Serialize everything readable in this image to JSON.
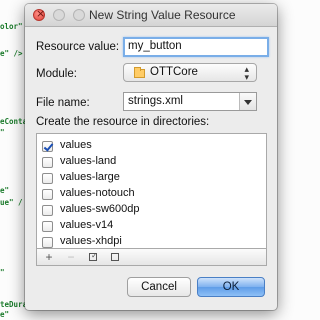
{
  "editor": {
    "lines": [
      {
        "text": "olor\"",
        "tail": ""
      },
      {
        "text": "e\" />",
        "tail": ""
      },
      {
        "text": "eConta",
        "tail": ""
      },
      {
        "text": "\"",
        "tail": ""
      },
      {
        "text": "e\"",
        "tail": ""
      },
      {
        "text": "ue\" /",
        "tail": ""
      },
      {
        "text": "\"",
        "tail": ""
      },
      {
        "text": "teDuration",
        "tail": ""
      },
      {
        "text": "e\"",
        "tail": ""
      }
    ]
  },
  "dialog": {
    "title": "New String Value Resource",
    "resource_value": {
      "label": "Resource value:",
      "value": "my_button"
    },
    "module": {
      "label": "Module:",
      "selected": "OTTCore"
    },
    "file_name": {
      "label": "File name:",
      "value": "strings.xml"
    },
    "directories": {
      "label": "Create the resource in directories:",
      "items": [
        {
          "name": "values",
          "checked": true
        },
        {
          "name": "values-land",
          "checked": false
        },
        {
          "name": "values-large",
          "checked": false
        },
        {
          "name": "values-notouch",
          "checked": false
        },
        {
          "name": "values-sw600dp",
          "checked": false
        },
        {
          "name": "values-v14",
          "checked": false
        },
        {
          "name": "values-xhdpi",
          "checked": false
        }
      ]
    },
    "toolbar": {
      "add": "+",
      "remove": "−"
    },
    "buttons": {
      "cancel": "Cancel",
      "ok": "OK"
    }
  }
}
